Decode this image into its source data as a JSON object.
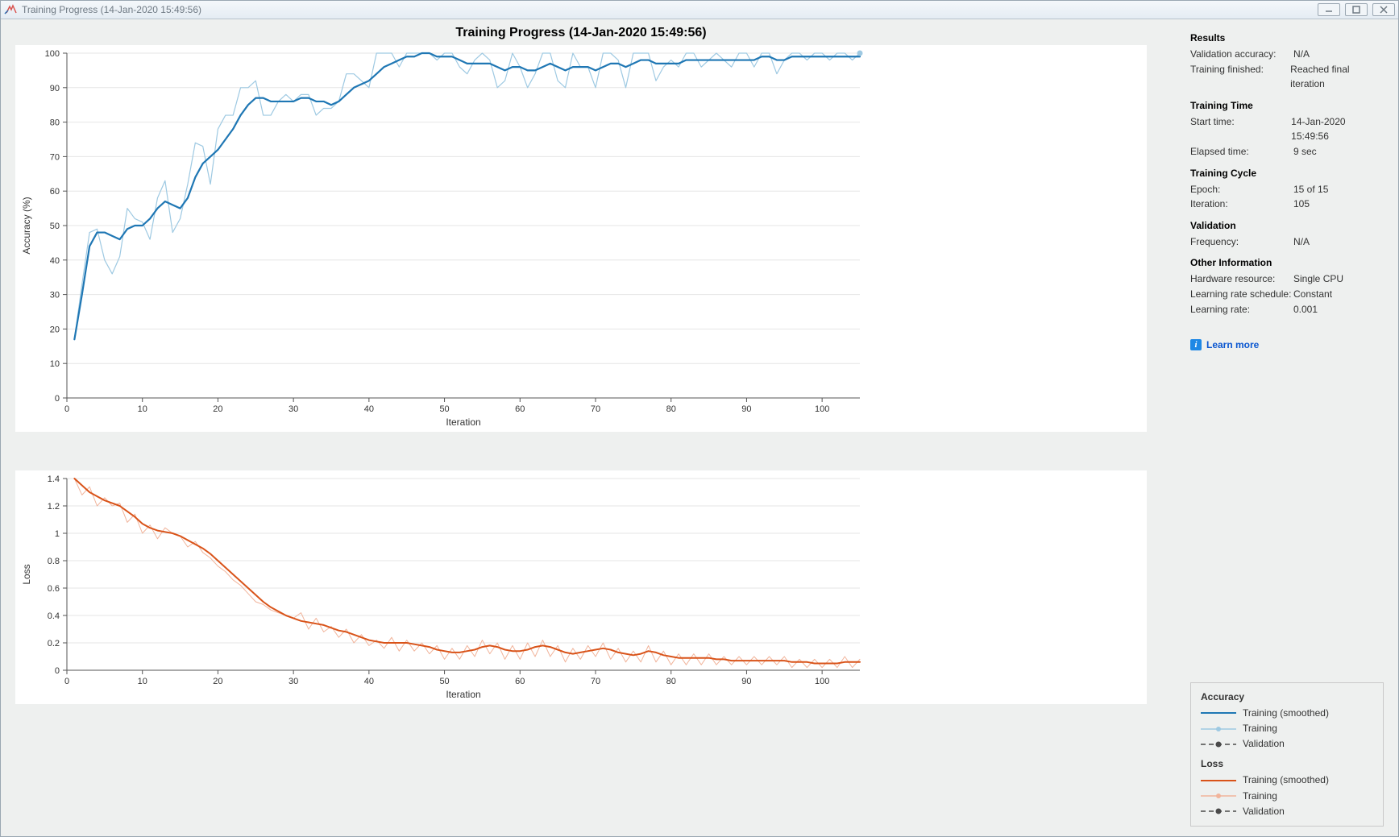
{
  "window": {
    "title": "Training Progress (14-Jan-2020 15:49:56)"
  },
  "page_title": "Training Progress (14-Jan-2020 15:49:56)",
  "side": {
    "results": {
      "heading": "Results",
      "validation_accuracy_label": "Validation accuracy:",
      "validation_accuracy_value": "N/A",
      "training_finished_label": "Training finished:",
      "training_finished_value": "Reached final iteration"
    },
    "training_time": {
      "heading": "Training Time",
      "start_time_label": "Start time:",
      "start_time_value": "14-Jan-2020 15:49:56",
      "elapsed_label": "Elapsed time:",
      "elapsed_value": "9 sec"
    },
    "training_cycle": {
      "heading": "Training Cycle",
      "epoch_label": "Epoch:",
      "epoch_value": "15 of 15",
      "iteration_label": "Iteration:",
      "iteration_value": "105"
    },
    "validation": {
      "heading": "Validation",
      "frequency_label": "Frequency:",
      "frequency_value": "N/A"
    },
    "other": {
      "heading": "Other Information",
      "hardware_label": "Hardware resource:",
      "hardware_value": "Single CPU",
      "lr_schedule_label": "Learning rate schedule:",
      "lr_schedule_value": "Constant",
      "lr_label": "Learning rate:",
      "lr_value": "0.001"
    },
    "learn_more": "Learn more"
  },
  "legend": {
    "acc_heading": "Accuracy",
    "loss_heading": "Loss",
    "training_smoothed": "Training (smoothed)",
    "training": "Training",
    "validation": "Validation"
  },
  "colors": {
    "acc_smoothed": "#1f77b4",
    "acc_raw": "#9ec9e2",
    "loss_smoothed": "#d95319",
    "loss_raw": "#f1b49b",
    "validation": "#4a4a4a",
    "grid": "#e6e6e6",
    "axis": "#555"
  },
  "chart_data": [
    {
      "type": "line",
      "title": "",
      "xlabel": "Iteration",
      "ylabel": "Accuracy (%)",
      "xlim": [
        0,
        105
      ],
      "ylim": [
        0,
        100
      ],
      "xticks": [
        0,
        10,
        20,
        30,
        40,
        50,
        60,
        70,
        80,
        90,
        100
      ],
      "yticks": [
        0,
        10,
        20,
        30,
        40,
        50,
        60,
        70,
        80,
        90,
        100
      ],
      "x": [
        1,
        2,
        3,
        4,
        5,
        6,
        7,
        8,
        9,
        10,
        11,
        12,
        13,
        14,
        15,
        16,
        17,
        18,
        19,
        20,
        21,
        22,
        23,
        24,
        25,
        26,
        27,
        28,
        29,
        30,
        31,
        32,
        33,
        34,
        35,
        36,
        37,
        38,
        39,
        40,
        41,
        42,
        43,
        44,
        45,
        46,
        47,
        48,
        49,
        50,
        51,
        52,
        53,
        54,
        55,
        56,
        57,
        58,
        59,
        60,
        61,
        62,
        63,
        64,
        65,
        66,
        67,
        68,
        69,
        70,
        71,
        72,
        73,
        74,
        75,
        76,
        77,
        78,
        79,
        80,
        81,
        82,
        83,
        84,
        85,
        86,
        87,
        88,
        89,
        90,
        91,
        92,
        93,
        94,
        95,
        96,
        97,
        98,
        99,
        100,
        101,
        102,
        103,
        104,
        105
      ],
      "series": [
        {
          "name": "Training (smoothed)",
          "color": "#1f77b4",
          "width": 2.2,
          "values": [
            17,
            30,
            44,
            48,
            48,
            47,
            46,
            49,
            50,
            50,
            52,
            55,
            57,
            56,
            55,
            58,
            64,
            68,
            70,
            72,
            75,
            78,
            82,
            85,
            87,
            87,
            86,
            86,
            86,
            86,
            87,
            87,
            86,
            86,
            85,
            86,
            88,
            90,
            91,
            92,
            94,
            96,
            97,
            98,
            99,
            99,
            100,
            100,
            99,
            99,
            99,
            98,
            97,
            97,
            97,
            97,
            96,
            95,
            96,
            96,
            95,
            95,
            96,
            97,
            96,
            95,
            96,
            96,
            96,
            95,
            96,
            97,
            97,
            96,
            97,
            98,
            98,
            97,
            97,
            97,
            97,
            98,
            98,
            98,
            98,
            98,
            98,
            98,
            98,
            98,
            98,
            99,
            99,
            98,
            98,
            99,
            99,
            99,
            99,
            99,
            99,
            99,
            99,
            99,
            99
          ]
        },
        {
          "name": "Training",
          "color": "#9ec9e2",
          "width": 1.2,
          "values": [
            17,
            33,
            48,
            49,
            40,
            36,
            41,
            55,
            52,
            51,
            46,
            58,
            63,
            48,
            52,
            62,
            74,
            73,
            62,
            78,
            82,
            82,
            90,
            90,
            92,
            82,
            82,
            86,
            88,
            86,
            88,
            88,
            82,
            84,
            84,
            86,
            94,
            94,
            92,
            90,
            100,
            100,
            100,
            96,
            100,
            100,
            100,
            100,
            98,
            100,
            100,
            96,
            94,
            98,
            100,
            98,
            90,
            92,
            100,
            96,
            90,
            94,
            100,
            100,
            92,
            90,
            100,
            96,
            96,
            90,
            100,
            100,
            98,
            90,
            100,
            100,
            100,
            92,
            96,
            98,
            96,
            100,
            100,
            96,
            98,
            100,
            98,
            96,
            100,
            100,
            96,
            100,
            100,
            94,
            98,
            100,
            100,
            98,
            100,
            100,
            98,
            100,
            100,
            98,
            100
          ]
        }
      ],
      "final_marker": {
        "x": 105,
        "y": 100,
        "color": "#9ec9e2"
      }
    },
    {
      "type": "line",
      "title": "",
      "xlabel": "Iteration",
      "ylabel": "Loss",
      "xlim": [
        0,
        105
      ],
      "ylim": [
        0,
        1.4
      ],
      "xticks": [
        0,
        10,
        20,
        30,
        40,
        50,
        60,
        70,
        80,
        90,
        100
      ],
      "yticks": [
        0,
        0.2,
        0.4,
        0.6,
        0.8,
        1.0,
        1.2,
        1.4
      ],
      "x": [
        1,
        2,
        3,
        4,
        5,
        6,
        7,
        8,
        9,
        10,
        11,
        12,
        13,
        14,
        15,
        16,
        17,
        18,
        19,
        20,
        21,
        22,
        23,
        24,
        25,
        26,
        27,
        28,
        29,
        30,
        31,
        32,
        33,
        34,
        35,
        36,
        37,
        38,
        39,
        40,
        41,
        42,
        43,
        44,
        45,
        46,
        47,
        48,
        49,
        50,
        51,
        52,
        53,
        54,
        55,
        56,
        57,
        58,
        59,
        60,
        61,
        62,
        63,
        64,
        65,
        66,
        67,
        68,
        69,
        70,
        71,
        72,
        73,
        74,
        75,
        76,
        77,
        78,
        79,
        80,
        81,
        82,
        83,
        84,
        85,
        86,
        87,
        88,
        89,
        90,
        91,
        92,
        93,
        94,
        95,
        96,
        97,
        98,
        99,
        100,
        101,
        102,
        103,
        104,
        105
      ],
      "series": [
        {
          "name": "Training (smoothed)",
          "color": "#d95319",
          "width": 2.0,
          "values": [
            1.4,
            1.35,
            1.3,
            1.27,
            1.24,
            1.22,
            1.2,
            1.16,
            1.12,
            1.07,
            1.04,
            1.02,
            1.01,
            1.0,
            0.98,
            0.95,
            0.92,
            0.89,
            0.85,
            0.8,
            0.75,
            0.7,
            0.65,
            0.6,
            0.55,
            0.5,
            0.46,
            0.43,
            0.4,
            0.38,
            0.36,
            0.35,
            0.34,
            0.33,
            0.31,
            0.29,
            0.28,
            0.26,
            0.24,
            0.22,
            0.21,
            0.2,
            0.2,
            0.2,
            0.2,
            0.19,
            0.18,
            0.17,
            0.15,
            0.14,
            0.13,
            0.13,
            0.14,
            0.15,
            0.17,
            0.18,
            0.17,
            0.15,
            0.14,
            0.14,
            0.15,
            0.17,
            0.18,
            0.17,
            0.15,
            0.13,
            0.12,
            0.13,
            0.14,
            0.15,
            0.16,
            0.15,
            0.13,
            0.12,
            0.11,
            0.12,
            0.14,
            0.13,
            0.11,
            0.1,
            0.09,
            0.09,
            0.09,
            0.09,
            0.09,
            0.08,
            0.08,
            0.07,
            0.07,
            0.07,
            0.07,
            0.07,
            0.07,
            0.07,
            0.07,
            0.06,
            0.06,
            0.06,
            0.05,
            0.05,
            0.05,
            0.05,
            0.06,
            0.06,
            0.06
          ]
        },
        {
          "name": "Training",
          "color": "#f1b49b",
          "width": 1.0,
          "values": [
            1.4,
            1.28,
            1.34,
            1.2,
            1.26,
            1.2,
            1.22,
            1.08,
            1.14,
            1.0,
            1.06,
            0.96,
            1.04,
            1.0,
            0.98,
            0.9,
            0.94,
            0.86,
            0.82,
            0.76,
            0.72,
            0.66,
            0.62,
            0.56,
            0.5,
            0.48,
            0.44,
            0.42,
            0.4,
            0.38,
            0.42,
            0.3,
            0.38,
            0.28,
            0.32,
            0.24,
            0.3,
            0.2,
            0.26,
            0.18,
            0.22,
            0.16,
            0.24,
            0.14,
            0.22,
            0.14,
            0.2,
            0.12,
            0.18,
            0.08,
            0.16,
            0.08,
            0.18,
            0.1,
            0.22,
            0.12,
            0.2,
            0.08,
            0.18,
            0.08,
            0.2,
            0.1,
            0.22,
            0.1,
            0.18,
            0.06,
            0.16,
            0.08,
            0.18,
            0.1,
            0.2,
            0.08,
            0.16,
            0.06,
            0.14,
            0.06,
            0.18,
            0.06,
            0.14,
            0.04,
            0.12,
            0.04,
            0.12,
            0.04,
            0.12,
            0.04,
            0.1,
            0.04,
            0.1,
            0.04,
            0.1,
            0.04,
            0.1,
            0.04,
            0.1,
            0.02,
            0.08,
            0.02,
            0.08,
            0.02,
            0.08,
            0.02,
            0.1,
            0.02,
            0.08
          ]
        }
      ]
    }
  ]
}
